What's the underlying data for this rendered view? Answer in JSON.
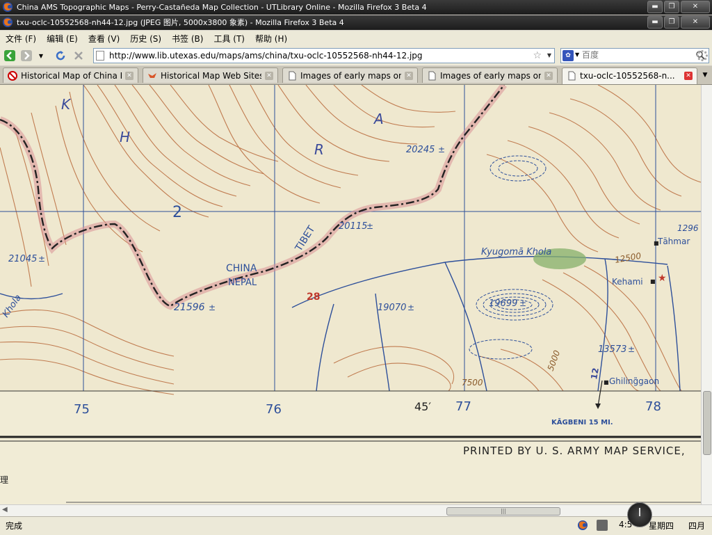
{
  "window_back": {
    "title": "China AMS Topographic Maps - Perry-Castañeda Map Collection - UTLibrary Online - Mozilla Firefox 3 Beta 4"
  },
  "window_front": {
    "title": "txu-oclc-10552568-nh44-12.jpg (JPEG 图片, 5000x3800 象素) - Mozilla Firefox 3 Beta 4"
  },
  "menu": [
    "文件 (F)",
    "编辑 (E)",
    "查看 (V)",
    "历史 (S)",
    "书签 (B)",
    "工具 (T)",
    "帮助 (H)"
  ],
  "address": {
    "url": "http://www.lib.utexas.edu/maps/ams/china/txu-oclc-10552568-nh44-12.jpg"
  },
  "search": {
    "placeholder": "百度"
  },
  "tabs": [
    {
      "label": "Historical Map of China Fr...",
      "icon": "blocked-site-icon"
    },
    {
      "label": "Historical Map Web Sites...",
      "icon": "fox-site-icon"
    },
    {
      "label": "Images of early maps on...",
      "icon": "page-icon"
    },
    {
      "label": "Images of early maps on...",
      "icon": "page-icon"
    },
    {
      "label": "txu-oclc-10552568-n...",
      "icon": "page-icon",
      "active": true
    }
  ],
  "map": {
    "range_letters": [
      "K",
      "H",
      "R",
      "A"
    ],
    "grid_number": "2",
    "country_labels": [
      "CHINA",
      "NEPAL",
      "TIBET"
    ],
    "elevations": [
      "20245",
      "20115",
      "21045",
      "21596",
      "19070",
      "19699",
      "13573",
      "1296"
    ],
    "river": "Kyugomā Khola",
    "contour_labels": [
      "12500",
      "5000",
      "7500"
    ],
    "villages": [
      "Tāhmar",
      "Kehami",
      "Ghiling̃gaon"
    ],
    "red_number": "28",
    "khola_left": "Khola",
    "route_number": "12",
    "edge_numbers": [
      "75",
      "76",
      "77",
      "78"
    ],
    "minutes": "45′",
    "direction": "KĀGBENI 15 MI.",
    "printed": "PRINTED BY U. S. ARMY MAP SERVICE,",
    "edge_char": "理"
  },
  "status": {
    "text": "完成",
    "time": "4:5",
    "day": "星期四",
    "month": "四月"
  },
  "colors": {
    "paper": "#f1ecd6",
    "contour_brown": "#b8693a",
    "grid_blue": "#2d4f9a",
    "boundary_red": "#c0505a",
    "forest_green": "#86b06a"
  }
}
